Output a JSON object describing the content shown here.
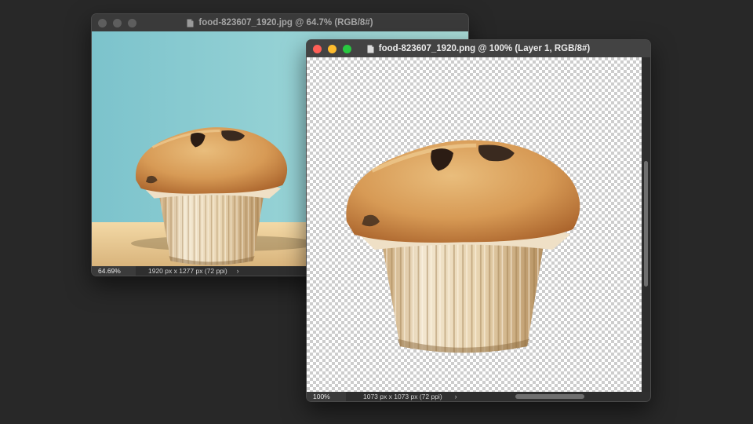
{
  "windows": [
    {
      "title": "food-823607_1920.jpg @ 64.7% (RGB/8#)",
      "zoom": "64.69%",
      "doc_info": "1920 px x 1277 px (72 ppi)",
      "state": "inactive"
    },
    {
      "title": "food-823607_1920.png @ 100% (Layer 1, RGB/8#)",
      "zoom": "100%",
      "doc_info": "1073 px x 1073 px (72 ppi)",
      "state": "active"
    }
  ],
  "icons": {
    "status_menu": "chevron-right-icon",
    "title": "document-icon"
  },
  "colors": {
    "close": "#ff5f57",
    "minimize": "#febc2e",
    "zoom": "#28c840",
    "inactive_light": "#5e5e5e",
    "app_background": "#282828",
    "photo_backdrop": "#8fcfd2",
    "table_surface": "#e9c895"
  },
  "status_chevron": "›"
}
